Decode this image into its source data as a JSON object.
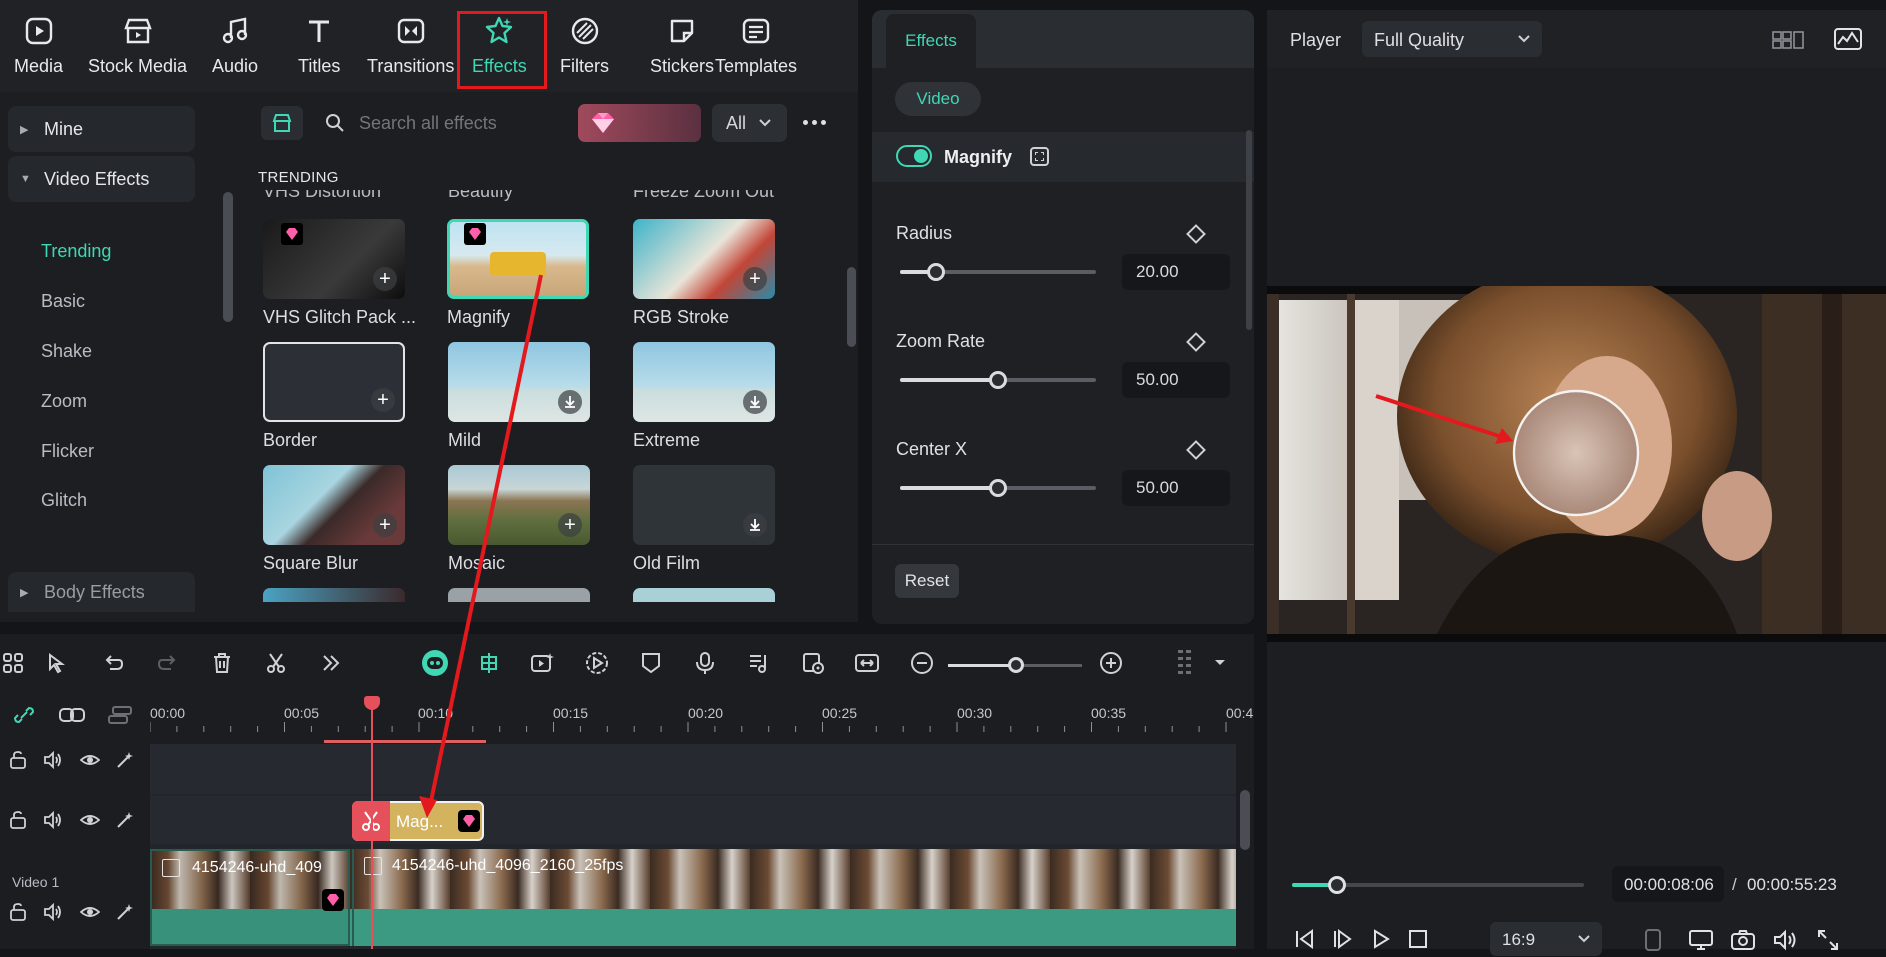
{
  "top_tabs": [
    {
      "label": "Media",
      "icon": "media-icon"
    },
    {
      "label": "Stock Media",
      "icon": "stock-media-icon"
    },
    {
      "label": "Audio",
      "icon": "audio-note-icon"
    },
    {
      "label": "Titles",
      "icon": "titles-t-icon"
    },
    {
      "label": "Transitions",
      "icon": "transitions-icon"
    },
    {
      "label": "Effects",
      "icon": "effects-star-icon",
      "active": true
    },
    {
      "label": "Filters",
      "icon": "filters-icon"
    },
    {
      "label": "Stickers",
      "icon": "stickers-icon"
    },
    {
      "label": "Templates",
      "icon": "templates-icon"
    }
  ],
  "sidebar": {
    "mine": "Mine",
    "video_effects": "Video Effects",
    "items": [
      "Trending",
      "Basic",
      "Shake",
      "Zoom",
      "Flicker",
      "Glitch"
    ],
    "body_effects": "Body Effects"
  },
  "search": {
    "placeholder": "Search all effects",
    "filter": "All"
  },
  "section_title": "TRENDING",
  "partial_labels": [
    "VHS Distortion",
    "Beautify",
    "Freeze Zoom Out"
  ],
  "effects": [
    {
      "label": "VHS Glitch Pack ...",
      "premium": true,
      "action": "add"
    },
    {
      "label": "Magnify",
      "premium": true,
      "selected": true
    },
    {
      "label": "RGB Stroke",
      "action": "add"
    },
    {
      "label": "Border",
      "action": "add"
    },
    {
      "label": "Mild",
      "action": "download"
    },
    {
      "label": "Extreme",
      "action": "download"
    },
    {
      "label": "Square Blur",
      "action": "add"
    },
    {
      "label": "Mosaic",
      "action": "add"
    },
    {
      "label": "Old Film",
      "action": "download"
    }
  ],
  "props": {
    "tab": "Effects",
    "subtab": "Video",
    "effect_name": "Magnify",
    "params": [
      {
        "label": "Radius",
        "value": "20.00",
        "level": 0.2
      },
      {
        "label": "Zoom Rate",
        "value": "50.00",
        "level": 0.5
      },
      {
        "label": "Center X",
        "value": "50.00",
        "level": 0.5
      }
    ],
    "reset": "Reset"
  },
  "player": {
    "label": "Player",
    "quality": "Full Quality",
    "current_time": "00:00:08:06",
    "separator": "/",
    "total_time": "00:00:55:23",
    "progress": 0.15,
    "ratio": "16:9"
  },
  "timeline": {
    "ruler": [
      "00:00",
      "00:05",
      "00:10",
      "00:15",
      "00:20",
      "00:25",
      "00:30",
      "00:35",
      "00:4"
    ],
    "effect_clip": "Mag...",
    "video_track": "Video 1",
    "clip1": "4154246-uhd_409",
    "clip2": "4154246-uhd_4096_2160_25fps"
  },
  "colors": {
    "accent": "#3fd7b4",
    "highlight": "#e3191d",
    "effect_clip": "#d4b35f",
    "video_bar": "#3c9a82"
  }
}
